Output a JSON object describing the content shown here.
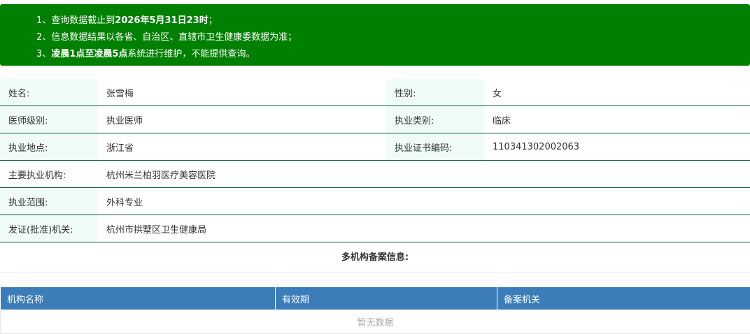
{
  "notice": {
    "line1_prefix": "1、查询数据截止到",
    "line1_bold": "2026年5月31日23时",
    "line1_suffix": "；",
    "line2": "2、信息数据结果以各省、自治区、直辖市卫生健康委数据为准；",
    "line3_prefix": "3、",
    "line3_bold": "凌晨1点至凌晨5点",
    "line3_suffix": "系统进行维护，不能提供查询。",
    "background_color": "#008000"
  },
  "info": {
    "name_label": "姓名:",
    "name_value": "张雪梅",
    "gender_label": "性别:",
    "gender_value": "女",
    "level_label": "医师级别:",
    "level_value": "执业医师",
    "category_label": "执业类别:",
    "category_value": "临床",
    "location_label": "执业地点:",
    "location_value": "浙江省",
    "cert_label": "执业证书编码:",
    "cert_value": "110341302002063",
    "institution_label": "主要执业机构:",
    "institution_value": "杭州米兰柏羽医疗美容医院",
    "scope_label": "执业范围:",
    "scope_value": "外科专业",
    "authority_label": "发证(批准)机关:",
    "authority_value": "杭州市拱墅区卫生健康局",
    "label_bg_color": "#f0fdf6",
    "border_color": "#0b5e4a"
  },
  "multi_org": {
    "title": "多机构备案信息:",
    "columns": [
      "机构名称",
      "有效期",
      "备案机关"
    ],
    "empty_text": "暂无数据",
    "header_color": "#3a7db9"
  }
}
